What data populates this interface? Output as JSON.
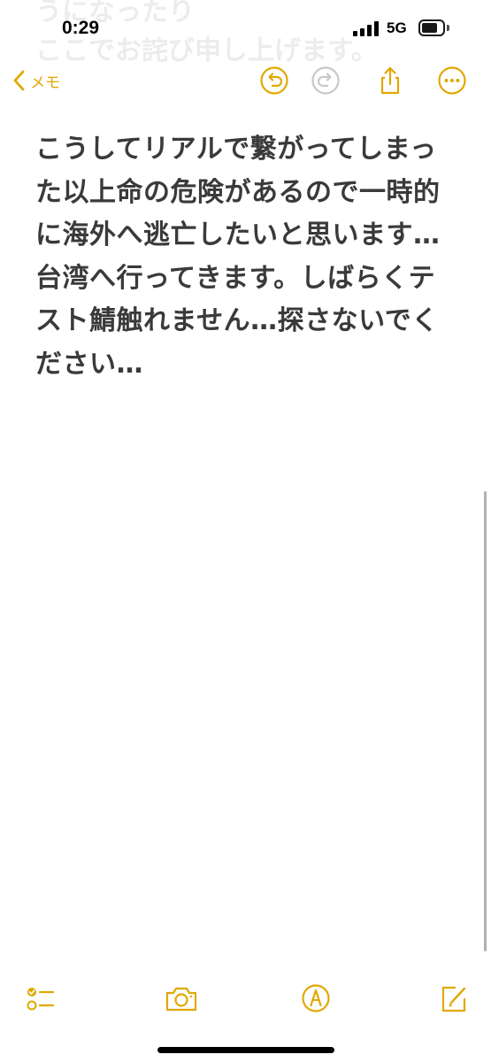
{
  "status_bar": {
    "time": "0:29",
    "network": "5G",
    "signal_bars": 4,
    "battery_level": 0.75
  },
  "background": {
    "scrolled_text_line1": "うになったり",
    "scrolled_text_line2": "ここでお詫び申し上げます。"
  },
  "nav": {
    "back_label": "メモ",
    "accent_color": "#e0a800",
    "icons": [
      "undo-icon",
      "redo-icon",
      "share-icon",
      "more-icon"
    ]
  },
  "note": {
    "text": "こうしてリアルで繋がってしまった以上命の危険があるので一時的に海外へ逃亡したいと思います…\n台湾へ行ってきます。しばらくテスト鯖触れません…探さないでください…"
  },
  "toolbar": {
    "icons": [
      "checklist-icon",
      "camera-icon",
      "markup-icon",
      "compose-icon"
    ]
  }
}
